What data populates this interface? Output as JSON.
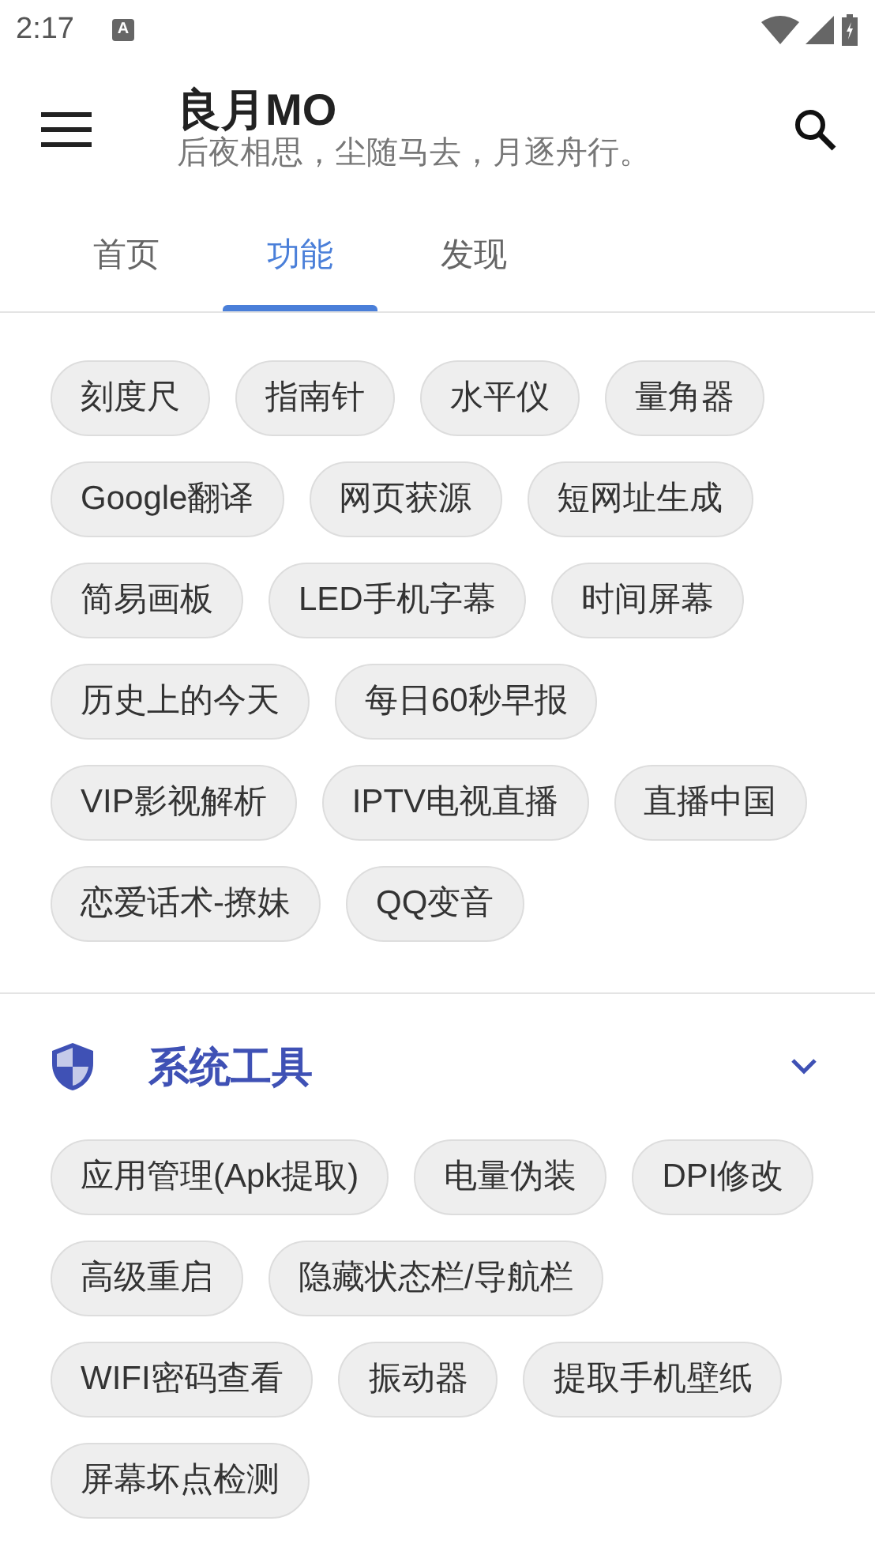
{
  "status_bar": {
    "time": "2:17",
    "notification": "A"
  },
  "app_bar": {
    "title": "良月MO",
    "subtitle": "后夜相思，尘随马去，月逐舟行。"
  },
  "tabs": [
    {
      "label": "首页",
      "selected": false
    },
    {
      "label": "功能",
      "selected": true
    },
    {
      "label": "发现",
      "selected": false
    }
  ],
  "sections": [
    {
      "chips": [
        "刻度尺",
        "指南针",
        "水平仪",
        "量角器",
        "Google翻译",
        "网页获源",
        "短网址生成",
        "简易画板",
        "LED手机字幕",
        "时间屏幕",
        "历史上的今天",
        "每日60秒早报",
        "VIP影视解析",
        "IPTV电视直播",
        "直播中国",
        "恋爱话术-撩妹",
        "QQ变音"
      ]
    },
    {
      "title": "系统工具",
      "expanded": true,
      "chips": [
        "应用管理(Apk提取)",
        "电量伪装",
        "DPI修改",
        "高级重启",
        "隐藏状态栏/导航栏",
        "WIFI密码查看",
        "振动器",
        "提取手机壁纸",
        "屏幕坏点检测"
      ]
    }
  ]
}
